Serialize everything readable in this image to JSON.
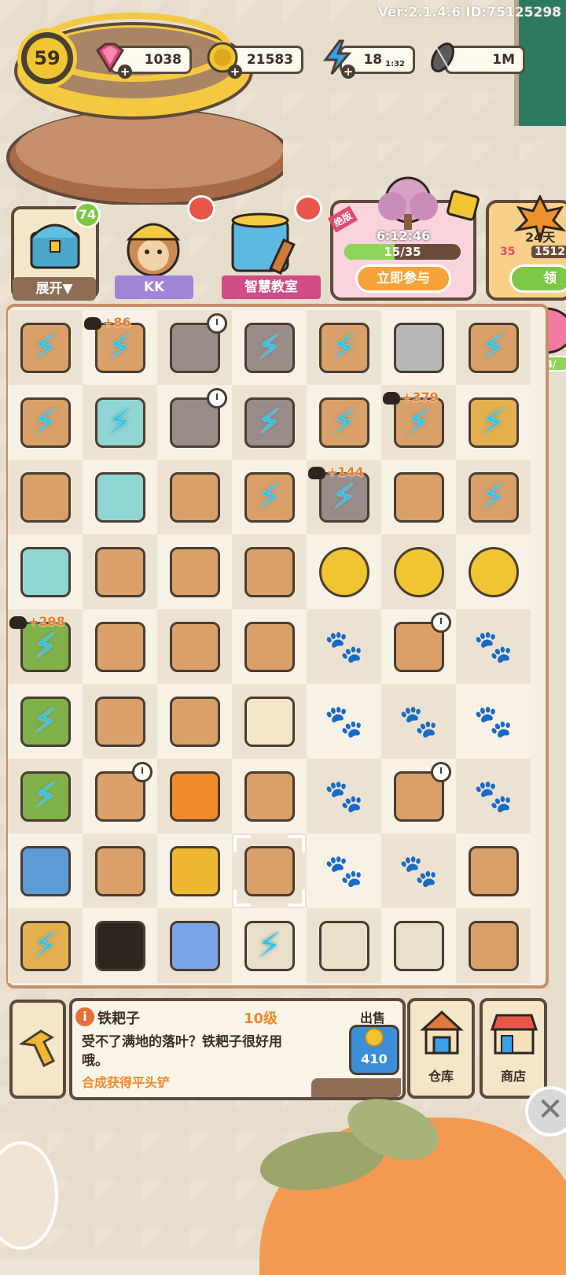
{
  "version_text": "Ver:2.1.4.6 ID:75125298",
  "player": {
    "level": "59"
  },
  "currencies": {
    "gems": "1038",
    "coins": "21583",
    "energy": "18",
    "energy_timer": "1:32",
    "seeds": "1M"
  },
  "colors": {
    "gem": "#e8407a",
    "coin": "#f0c531",
    "energy": "#3aa0ea",
    "accent_orange": "#f08a2c",
    "board_border": "#c58f6b"
  },
  "shortcuts": {
    "chest_badge": "74",
    "chest_label": "展开▼",
    "kk_label": "KK",
    "classroom_label": "智慧教室"
  },
  "event1": {
    "tag": "绝版",
    "timer": "6:12:46",
    "progress_text": "15/35",
    "progress": 0.43,
    "button": "立即参与"
  },
  "event2": {
    "days": "24天",
    "stat1": "35",
    "stat2": "1512",
    "button": "领"
  },
  "piggy": {
    "progress_text": "134/"
  },
  "board": {
    "cols": 7,
    "rows": 9,
    "cells": [
      [
        "shelf-bolt",
        "door-bolt-cat",
        "locomotive-clock",
        "cart-bolt",
        "crate-bolt",
        "platform",
        "tools-bolt"
      ],
      [
        "cabinet-bolt",
        "glass-door-bolt",
        "train-car-clock",
        "cart-bolt",
        "toolbox-bolt",
        "basket-bolt-cat",
        "pot-bolt"
      ],
      [
        "box",
        "stool",
        "toolbox",
        "wheelbarrow-bolt",
        "toolcart-bolt-cat",
        "wheelbarrow",
        "gold-rock-bolt"
      ],
      [
        "tray",
        "handle",
        "toolbox-open",
        "dirt-box",
        "coins-2",
        "coins-3",
        "coins-stack"
      ],
      [
        "tree-bolt-cat",
        "wall-lamp",
        "heater",
        "bulb-lamp",
        "paw",
        "vase-clock",
        "paw"
      ],
      [
        "tree-bolt",
        "projector",
        "spray-bottle",
        "lamp",
        "paw",
        "paw",
        "paw"
      ],
      [
        "tree-bolt",
        "tripod-lamp-clock",
        "amber",
        "bulb",
        "paw",
        "flower-vase-clock",
        "paw"
      ],
      [
        "arcade",
        "wrenches",
        "hard-hat",
        "rake-selected",
        "paw",
        "paw",
        "trowel"
      ],
      [
        "pot-bolt",
        "black-cat",
        "blue-flower",
        "planter-bolt",
        "planter-blue",
        "planter-green",
        "saw"
      ]
    ],
    "cat_bonuses": [
      {
        "row": 0,
        "col": 1,
        "text": "+86"
      },
      {
        "row": 1,
        "col": 5,
        "text": "+379"
      },
      {
        "row": 2,
        "col": 4,
        "text": "+144"
      },
      {
        "row": 4,
        "col": 0,
        "text": "+298"
      }
    ]
  },
  "selected_item": {
    "name": "铁耙子",
    "level": "10级",
    "description": "受不了满地的落叶？铁耙子很好用哦。",
    "hint": "合成获得平头铲",
    "sell_label": "出售",
    "sell_price": "410"
  },
  "buttons": {
    "warehouse": "仓库",
    "shop": "商店"
  }
}
